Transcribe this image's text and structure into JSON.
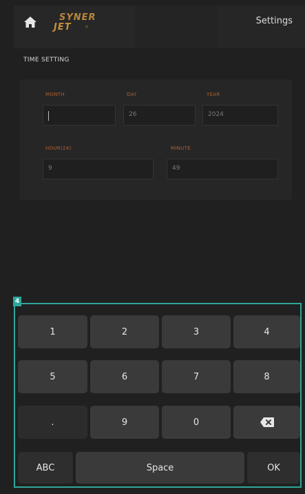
{
  "header": {
    "logo_line1": "SYNER",
    "logo_line2": "JET",
    "logo_sub": "®",
    "settings_label": "Settings"
  },
  "section": {
    "title": "TIME SETTING"
  },
  "fields": {
    "month": {
      "label": "MONTH",
      "value": ""
    },
    "day": {
      "label": "DAY",
      "value": "26"
    },
    "year": {
      "label": "YEAR",
      "value": "2024"
    },
    "hour": {
      "label": "HOUR(24)",
      "value": "9"
    },
    "minute": {
      "label": "MINUTE",
      "value": "49"
    }
  },
  "keyboard": {
    "tag": "4",
    "rows": [
      [
        "1",
        "2",
        "3",
        "4"
      ],
      [
        "5",
        "6",
        "7",
        "8"
      ],
      [
        ".",
        "9",
        "0",
        "backspace"
      ],
      [
        "ABC",
        "Space",
        "OK"
      ]
    ],
    "labels": {
      "k1": "1",
      "k2": "2",
      "k3": "3",
      "k4": "4",
      "k5": "5",
      "k6": "6",
      "k7": "7",
      "k8": "8",
      "dot": ".",
      "k9": "9",
      "k0": "0",
      "abc": "ABC",
      "space": "Space",
      "ok": "OK"
    }
  },
  "colors": {
    "accent": "#2ea79a",
    "label_orange": "#b0612f",
    "logo_gold": "#c6923e"
  }
}
